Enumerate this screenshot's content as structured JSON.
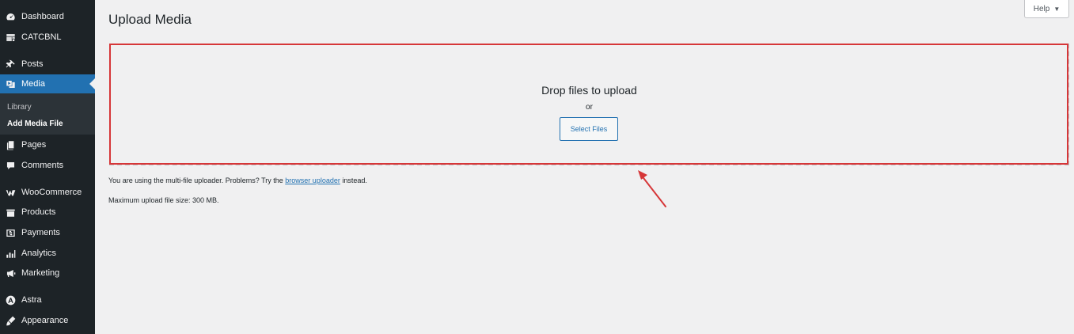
{
  "sidebar": {
    "items": [
      {
        "label": "Dashboard",
        "icon": "dashboard-icon"
      },
      {
        "label": "CATCBNL",
        "icon": "catcbnl-icon"
      },
      {
        "label": "Posts",
        "icon": "pin-icon"
      },
      {
        "label": "Media",
        "icon": "media-icon",
        "active": true
      },
      {
        "label": "Pages",
        "icon": "pages-icon"
      },
      {
        "label": "Comments",
        "icon": "comments-icon"
      },
      {
        "label": "WooCommerce",
        "icon": "woocommerce-icon"
      },
      {
        "label": "Products",
        "icon": "products-icon"
      },
      {
        "label": "Payments",
        "icon": "payments-icon"
      },
      {
        "label": "Analytics",
        "icon": "analytics-icon"
      },
      {
        "label": "Marketing",
        "icon": "marketing-icon"
      },
      {
        "label": "Astra",
        "icon": "astra-icon"
      },
      {
        "label": "Appearance",
        "icon": "appearance-icon"
      }
    ],
    "submenu": [
      {
        "label": "Library"
      },
      {
        "label": "Add Media File",
        "current": true
      }
    ]
  },
  "header": {
    "title": "Upload Media",
    "help_label": "Help",
    "help_caret": "▼"
  },
  "uploader": {
    "drop_text": "Drop files to upload",
    "or_text": "or",
    "select_label": "Select Files"
  },
  "info": {
    "multi_prefix": "You are using the multi-file uploader. Problems? Try the ",
    "browser_link": "browser uploader",
    "multi_suffix": " instead.",
    "max_size": "Maximum upload file size: 300 MB."
  },
  "colors": {
    "sidebar_bg": "#1d2327",
    "accent": "#2271b1",
    "highlight": "#d63638"
  }
}
